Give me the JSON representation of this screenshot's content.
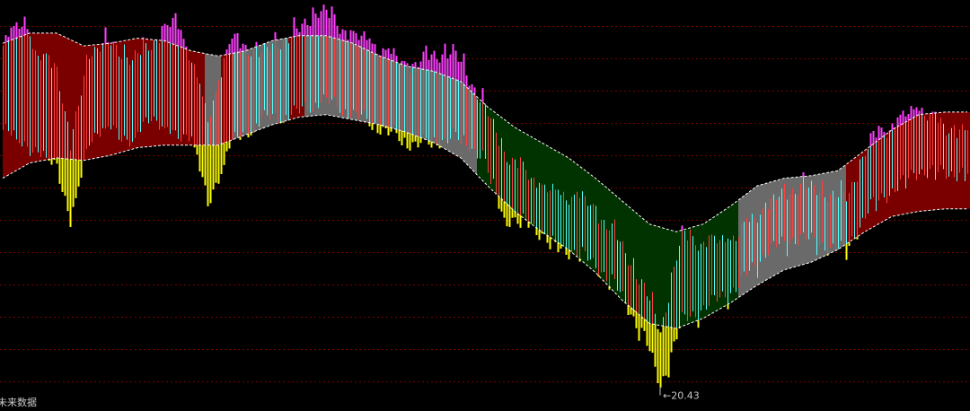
{
  "chart_data": {
    "type": "band_candlestick",
    "title": "",
    "x_label": "",
    "y_label": "",
    "y_range": [
      19.6,
      35.6
    ],
    "grid": true,
    "annotations": {
      "max_price": "",
      "min_price": "20.43",
      "footer_label": "未来数据"
    },
    "band_colors": {
      "up": "#7a0000",
      "neutral": "#6a6a6a",
      "down": "#003300"
    },
    "bar_colors": {
      "up": "#ff4040",
      "down": "#54ffff",
      "above_band": "#ff40ff",
      "below_band": "#ffff00"
    },
    "band_segments": [
      {
        "state": "up",
        "from_bar": 0,
        "to_bar": 75
      },
      {
        "state": "neutral",
        "from_bar": 75,
        "to_bar": 81
      },
      {
        "state": "up",
        "from_bar": 81,
        "to_bar": 85
      },
      {
        "state": "neutral",
        "from_bar": 85,
        "to_bar": 106
      },
      {
        "state": "up",
        "from_bar": 106,
        "to_bar": 112
      },
      {
        "state": "neutral",
        "from_bar": 112,
        "to_bar": 176
      },
      {
        "state": "down",
        "from_bar": 176,
        "to_bar": 273
      },
      {
        "state": "neutral",
        "from_bar": 273,
        "to_bar": 313
      },
      {
        "state": "up",
        "from_bar": 313,
        "to_bar": 359
      }
    ],
    "bar_count": 359,
    "band_upper": [
      [
        0,
        33.9
      ],
      [
        10,
        34.3
      ],
      [
        20,
        34.3
      ],
      [
        30,
        33.8
      ],
      [
        40,
        33.9
      ],
      [
        50,
        34.1
      ],
      [
        60,
        34.0
      ],
      [
        70,
        33.6
      ],
      [
        80,
        33.4
      ],
      [
        90,
        33.6
      ],
      [
        100,
        34.0
      ],
      [
        110,
        34.2
      ],
      [
        120,
        34.2
      ],
      [
        130,
        33.9
      ],
      [
        140,
        33.4
      ],
      [
        150,
        33.0
      ],
      [
        160,
        32.8
      ],
      [
        170,
        32.4
      ],
      [
        180,
        31.4
      ],
      [
        190,
        30.6
      ],
      [
        200,
        30.0
      ],
      [
        210,
        29.4
      ],
      [
        220,
        28.6
      ],
      [
        230,
        27.7
      ],
      [
        240,
        26.8
      ],
      [
        250,
        26.5
      ],
      [
        260,
        26.8
      ],
      [
        270,
        27.5
      ],
      [
        280,
        28.3
      ],
      [
        290,
        28.6
      ],
      [
        300,
        28.7
      ],
      [
        310,
        28.9
      ],
      [
        320,
        29.7
      ],
      [
        330,
        30.5
      ],
      [
        340,
        31.1
      ],
      [
        350,
        31.2
      ],
      [
        358,
        31.2
      ]
    ],
    "band_lower": [
      [
        0,
        28.6
      ],
      [
        10,
        29.2
      ],
      [
        20,
        29.4
      ],
      [
        30,
        29.3
      ],
      [
        40,
        29.5
      ],
      [
        50,
        29.8
      ],
      [
        60,
        29.9
      ],
      [
        70,
        29.9
      ],
      [
        80,
        29.9
      ],
      [
        90,
        30.3
      ],
      [
        100,
        30.7
      ],
      [
        110,
        31.0
      ],
      [
        120,
        31.1
      ],
      [
        130,
        30.9
      ],
      [
        140,
        30.7
      ],
      [
        150,
        30.4
      ],
      [
        160,
        30.0
      ],
      [
        170,
        29.4
      ],
      [
        180,
        28.3
      ],
      [
        190,
        27.3
      ],
      [
        200,
        26.5
      ],
      [
        210,
        25.8
      ],
      [
        220,
        24.9
      ],
      [
        230,
        23.8
      ],
      [
        240,
        22.9
      ],
      [
        250,
        22.7
      ],
      [
        260,
        23.1
      ],
      [
        270,
        23.7
      ],
      [
        280,
        24.4
      ],
      [
        290,
        25.0
      ],
      [
        300,
        25.3
      ],
      [
        310,
        25.8
      ],
      [
        320,
        26.5
      ],
      [
        330,
        27.1
      ],
      [
        340,
        27.3
      ],
      [
        350,
        27.4
      ],
      [
        358,
        27.4
      ]
    ],
    "bar_samples": [
      [
        0,
        30.5,
        33.8
      ],
      [
        8,
        30.0,
        34.9
      ],
      [
        12,
        29.6,
        33.4
      ],
      [
        20,
        29.2,
        33.0
      ],
      [
        25,
        26.8,
        29.8
      ],
      [
        32,
        30.2,
        33.6
      ],
      [
        40,
        30.6,
        33.9
      ],
      [
        48,
        30.0,
        33.2
      ],
      [
        55,
        31.1,
        33.9
      ],
      [
        64,
        30.2,
        34.8
      ],
      [
        70,
        30.4,
        33.3
      ],
      [
        76,
        27.5,
        30.8
      ],
      [
        84,
        29.9,
        34.0
      ],
      [
        96,
        30.9,
        33.5
      ],
      [
        110,
        31.2,
        34.4
      ],
      [
        118,
        31.7,
        35.3
      ],
      [
        125,
        31.4,
        34.5
      ],
      [
        140,
        30.6,
        33.7
      ],
      [
        150,
        30.0,
        33.0
      ],
      [
        160,
        30.0,
        33.4
      ],
      [
        167,
        30.3,
        33.6
      ],
      [
        178,
        29.5,
        31.6
      ],
      [
        186,
        27.0,
        29.6
      ],
      [
        196,
        26.8,
        28.6
      ],
      [
        206,
        25.8,
        27.9
      ],
      [
        214,
        25.7,
        27.9
      ],
      [
        226,
        24.6,
        26.6
      ],
      [
        238,
        22.4,
        24.3
      ],
      [
        244,
        20.43,
        22.6
      ],
      [
        252,
        23.0,
        26.4
      ],
      [
        260,
        23.5,
        26.0
      ],
      [
        272,
        24.3,
        26.3
      ],
      [
        284,
        25.8,
        27.6
      ],
      [
        296,
        26.3,
        28.3
      ],
      [
        306,
        25.9,
        28.0
      ],
      [
        313,
        25.8,
        27.8
      ],
      [
        322,
        27.5,
        30.1
      ],
      [
        340,
        28.9,
        31.4
      ],
      [
        350,
        28.8,
        30.5
      ]
    ]
  }
}
